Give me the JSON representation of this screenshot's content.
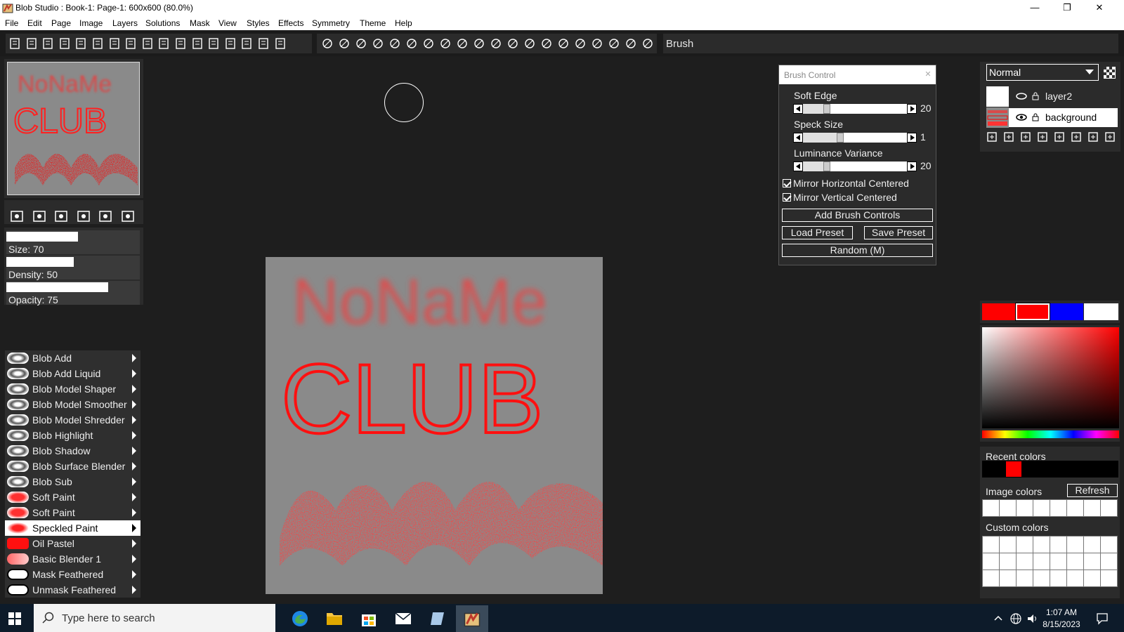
{
  "titlebar": {
    "title": "Blob Studio : Book-1: Page-1: 600x600 (80.0%)"
  },
  "menu": [
    "File",
    "Edit",
    "Page",
    "Image",
    "Layers",
    "Solutions",
    "Mask",
    "View",
    "Styles",
    "Effects",
    "Symmetry",
    "Theme",
    "Help"
  ],
  "toolbar": {
    "tool_name": "Brush"
  },
  "thumbnail": {
    "line1": "NoNaMe",
    "line2": "CLUB"
  },
  "sliders": [
    {
      "label": "Size: 70",
      "value": 70
    },
    {
      "label": "Density: 50",
      "value": 50
    },
    {
      "label": "Opacity: 75",
      "value": 75
    }
  ],
  "brushes": [
    {
      "label": "Blob Add",
      "icon": "blob-add-icon",
      "selected": false
    },
    {
      "label": "Blob Add Liquid",
      "icon": "blob-add-liquid-icon",
      "selected": false
    },
    {
      "label": "Blob Model Shaper",
      "icon": "blob-model-shaper-icon",
      "selected": false
    },
    {
      "label": "Blob Model Smoother",
      "icon": "blob-model-smoother-icon",
      "selected": false
    },
    {
      "label": "Blob Model Shredder",
      "icon": "blob-model-shredder-icon",
      "selected": false
    },
    {
      "label": "Blob Highlight",
      "icon": "blob-highlight-icon",
      "selected": false
    },
    {
      "label": "Blob Shadow",
      "icon": "blob-shadow-icon",
      "selected": false
    },
    {
      "label": "Blob Surface Blender",
      "icon": "blob-surface-blender-icon",
      "selected": false
    },
    {
      "label": "Blob Sub",
      "icon": "blob-sub-icon",
      "selected": false
    },
    {
      "label": "Soft Paint",
      "icon": "soft-paint-icon",
      "selected": false
    },
    {
      "label": "Soft Paint",
      "icon": "soft-paint-icon",
      "selected": false
    },
    {
      "label": "Speckled Paint",
      "icon": "speckled-paint-icon",
      "selected": true
    },
    {
      "label": "Oil Pastel",
      "icon": "oil-pastel-icon",
      "selected": false
    },
    {
      "label": "Basic Blender 1",
      "icon": "basic-blender-icon",
      "selected": false
    },
    {
      "label": "Mask Feathered",
      "icon": "mask-feathered-icon",
      "selected": false
    },
    {
      "label": "Unmask Feathered",
      "icon": "unmask-feathered-icon",
      "selected": false
    }
  ],
  "canvas": {
    "line1": "NoNaMe",
    "line2": "CLUB",
    "background": "#8a8a8a",
    "paint_color": "#ff0000"
  },
  "brush_control": {
    "title": "Brush Control",
    "soft_edge_label": "Soft Edge",
    "soft_edge_value": "20",
    "speck_size_label": "Speck Size",
    "speck_size_value": "1",
    "luminance_label": "Luminance Variance",
    "luminance_value": "20",
    "mirror_h": "Mirror Horizontal Centered",
    "mirror_v": "Mirror Vertical Centered",
    "add_controls": "Add Brush Controls",
    "load_preset": "Load Preset",
    "save_preset": "Save Preset",
    "random": "Random (M)"
  },
  "layers": {
    "blend_mode": "Normal",
    "items": [
      {
        "name": "layer2",
        "selected": false
      },
      {
        "name": "background",
        "selected": true
      }
    ]
  },
  "colors": {
    "swatches": [
      "#ff0000",
      "#ff0000",
      "#0000ff",
      "#ffffff"
    ],
    "recent_label": "Recent colors",
    "recent": [
      "#000000",
      "#ff0000"
    ],
    "image_label": "Image colors",
    "refresh": "Refresh",
    "custom_label": "Custom colors"
  },
  "taskbar": {
    "search_placeholder": "Type here to search",
    "time": "1:07 AM",
    "date": "8/15/2023"
  }
}
